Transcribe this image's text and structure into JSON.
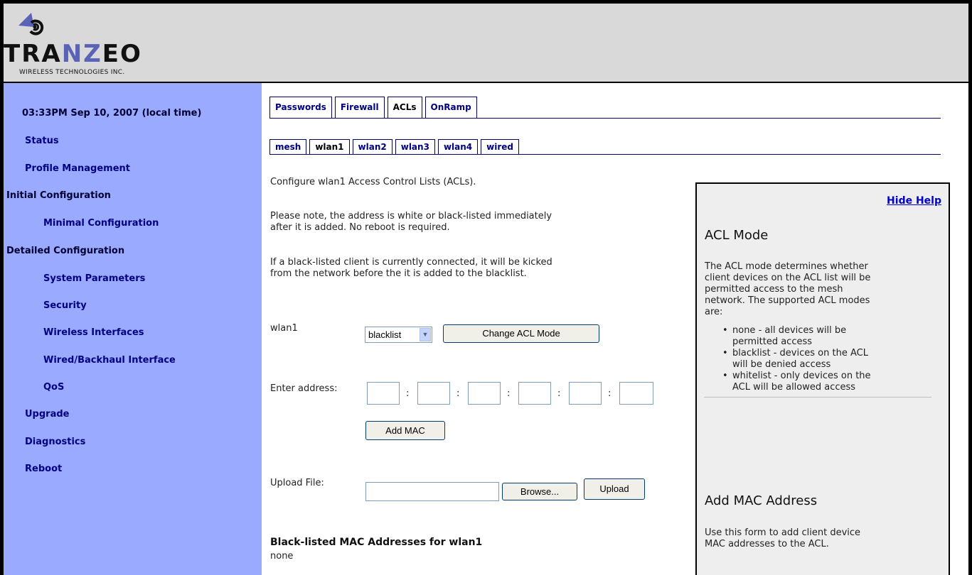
{
  "brand": {
    "name_left": "TRA",
    "name_mid": "NZ",
    "name_right": "EO",
    "tagline": "WIRELESS TECHNOLOGIES INC.",
    "logo_icon": "antenna-swirl-icon",
    "accent_color": "#5b63b8"
  },
  "sidebar": {
    "time": "03:33PM Sep 10, 2007 (local time)",
    "items": [
      {
        "label": "Status"
      },
      {
        "label": "Profile Management"
      },
      {
        "label": "Initial Configuration"
      },
      {
        "label": "Minimal Configuration"
      },
      {
        "label": "Detailed Configuration"
      },
      {
        "label": "System Parameters"
      },
      {
        "label": "Security"
      },
      {
        "label": "Wireless Interfaces"
      },
      {
        "label": "Wired/Backhaul Interface"
      },
      {
        "label": "QoS"
      },
      {
        "label": "Upgrade"
      },
      {
        "label": "Diagnostics"
      },
      {
        "label": "Reboot"
      }
    ],
    "bg_color": "#99aaff"
  },
  "tabs": {
    "primary": [
      "Passwords",
      "Firewall",
      "ACLs",
      "OnRamp"
    ],
    "primary_active": "ACLs",
    "secondary": [
      "mesh",
      "wlan1",
      "wlan2",
      "wlan3",
      "wlan4",
      "wired"
    ],
    "secondary_active": "wlan1"
  },
  "main": {
    "intro": "Configure wlan1 Access Control Lists (ACLs).",
    "note1_line1": "Please note, the address is white or black-listed immediately",
    "note1_line2": "after it is added. No reboot is required.",
    "note2_line1": "If a black-listed client is currently connected, it will be kicked",
    "note2_line2": "from the network before the it is added to the blacklist.",
    "mode_label": "wlan1",
    "mode_value": "blacklist",
    "change_mode_button": "Change ACL Mode",
    "address_label": "Enter address:",
    "address_separator": ":",
    "add_mac_button": "Add MAC",
    "upload_label": "Upload File:",
    "browse_button": "Browse...",
    "upload_button": "Upload",
    "list_title": "Black-listed MAC Addresses for wlan1",
    "list_value": "none"
  },
  "help": {
    "hide_link": "Hide Help",
    "section1_title": "ACL Mode",
    "section1_line1": "The ACL mode determines whether",
    "section1_line2": "client devices on the ACL list will be",
    "section1_line3": "permitted access to the mesh",
    "section1_line4": "network. The supported ACL modes",
    "section1_line5": "are:",
    "modes": [
      {
        "line1": "none - all devices will be",
        "line2": "permitted access"
      },
      {
        "line1": "blacklist - devices on the ACL",
        "line2": "will be denied access"
      },
      {
        "line1": "whitelist - only devices on the",
        "line2": "ACL will be allowed access"
      }
    ],
    "section2_title": "Add MAC Address",
    "section2_line1": "Use this form to add client device",
    "section2_line2": "MAC addresses to the ACL."
  }
}
